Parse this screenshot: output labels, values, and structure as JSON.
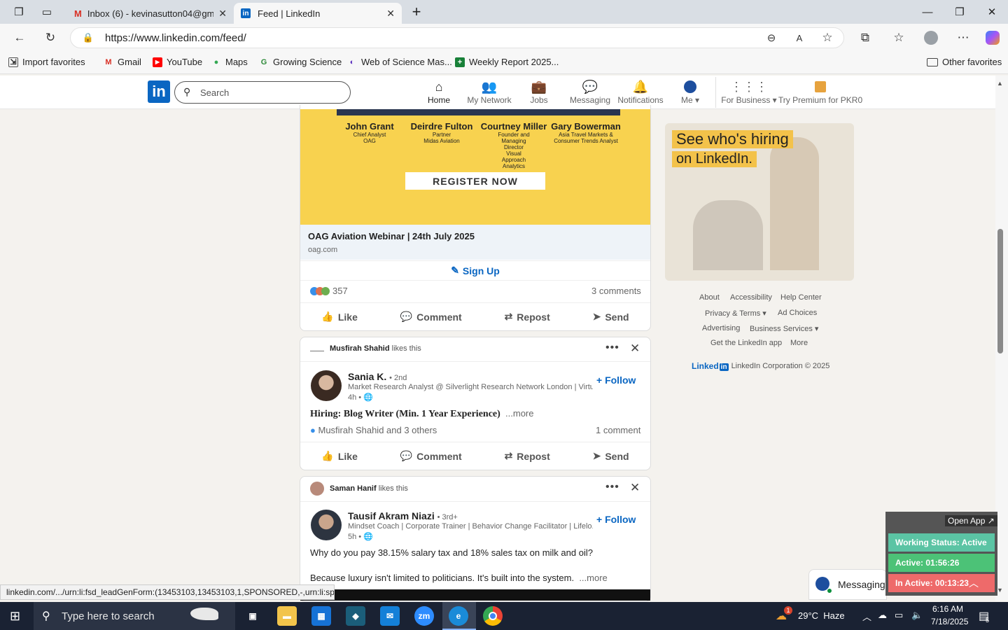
{
  "browser": {
    "tabs": [
      {
        "title": "Inbox (6) - kevinasutton04@gmai",
        "icon": "gmail-icon"
      },
      {
        "title": "Feed | LinkedIn",
        "icon": "linkedin-icon"
      }
    ],
    "url": "https://www.linkedin.com/feed/",
    "favorites": [
      {
        "label": "Import favorites",
        "icon": "import-icon",
        "color": "#555555"
      },
      {
        "label": "Gmail",
        "icon": "gmail-icon",
        "color": "#d93025"
      },
      {
        "label": "YouTube",
        "icon": "youtube-icon",
        "color": "#ff0000"
      },
      {
        "label": "Maps",
        "icon": "maps-icon",
        "color": "#34a853"
      },
      {
        "label": "Growing Science",
        "icon": "growing-science-icon",
        "color": "#2e8b3a"
      },
      {
        "label": "Web of Science Mas...",
        "icon": "web-of-science-icon",
        "color": "#5e33bf"
      },
      {
        "label": "Weekly Report 2025...",
        "icon": "sheets-icon",
        "color": "#188038"
      }
    ],
    "other_favorites": "Other favorites",
    "status_url": "linkedin.com/.../urn:li:fsd_leadGenForm:(13453103,13453103,1,SPONSORED,-,urn:li:spo..."
  },
  "linkedin": {
    "search_placeholder": "Search",
    "nav": [
      {
        "label": "Home",
        "icon": "home-icon",
        "active": true
      },
      {
        "label": "My Network",
        "icon": "network-icon"
      },
      {
        "label": "Jobs",
        "icon": "jobs-icon"
      },
      {
        "label": "Messaging",
        "icon": "messaging-icon"
      },
      {
        "label": "Notifications",
        "icon": "bell-icon"
      },
      {
        "label": "Me",
        "icon": "avatar-icon"
      }
    ],
    "for_business": "For Business",
    "premium": "Try Premium for PKR0",
    "brand_color": "#0a66c2"
  },
  "ad_post": {
    "speakers": [
      {
        "name": "John Grant",
        "role": "Chief Analyst",
        "org": "OAG"
      },
      {
        "name": "Deirdre Fulton",
        "role": "Partner",
        "org": "Midas Aviation"
      },
      {
        "name": "Courtney Miller",
        "role": "Founder and Managing Director",
        "org": "Visual Approach Analytics"
      },
      {
        "name": "Gary Bowerman",
        "role": "Asia Travel Markets &",
        "org": "Consumer Trends Analyst"
      }
    ],
    "register_label": "REGISTER NOW",
    "title": "OAG Aviation Webinar | 24th July 2025",
    "domain": "oag.com",
    "cta": "Sign Up",
    "reactions": "357",
    "comments": "3 comments",
    "actions": [
      "Like",
      "Comment",
      "Repost",
      "Send"
    ]
  },
  "post2": {
    "liked_by": "Musfirah Shahid",
    "liked_suffix": "likes this",
    "author": "Sania K.",
    "degree": "• 2nd",
    "headline": "Market Research Analyst @ Silverlight Research Network London | Virtu...",
    "time": "4h •",
    "follow": "Follow",
    "text": "Hiring: Blog Writer (Min. 1 Year Experience)",
    "more": "...more",
    "reactors": "Musfirah Shahid and 3 others",
    "comments": "1 comment",
    "actions": [
      "Like",
      "Comment",
      "Repost",
      "Send"
    ]
  },
  "post3": {
    "liked_by": "Saman Hanif",
    "liked_suffix": "likes this",
    "author": "Tausif Akram Niazi",
    "degree": "• 3rd+",
    "headline": "Mindset Coach | Corporate Trainer | Behavior Change Facilitator | Lifelo...",
    "time": "5h •",
    "follow": "Follow",
    "line1": "Why do you pay 38.15% salary tax and 18% sales tax on milk and oil?",
    "line2": "Because luxury isn't limited to politicians. It's built into the system.",
    "more": "...more"
  },
  "sidebar": {
    "promo_line1": "See who's hiring",
    "promo_line2": "on LinkedIn.",
    "footer_rows": [
      [
        "About",
        "Accessibility",
        "Help Center"
      ],
      [
        "Privacy & Terms ▾",
        "Ad Choices"
      ],
      [
        "Advertising",
        "Business Services ▾"
      ],
      [
        "Get the LinkedIn app",
        "More"
      ]
    ],
    "corp_logo": "Linked",
    "corp": "LinkedIn Corporation © 2025"
  },
  "tracker": {
    "open_app": "Open App ↗",
    "working": "Working Status: Active",
    "active": "Active: 01:56:26",
    "inactive": "In Active: 00:13:23",
    "colors": {
      "working": "#5bc4a4",
      "active": "#4cc277",
      "inactive": "#ee6a6a"
    }
  },
  "messaging": {
    "label": "Messaging"
  },
  "taskbar": {
    "search_placeholder": "Type here to search",
    "weather": "29°C  Haze",
    "weather_badge": "1",
    "time": "6:16 AM",
    "date": "7/18/2025",
    "notif_count": "5"
  }
}
